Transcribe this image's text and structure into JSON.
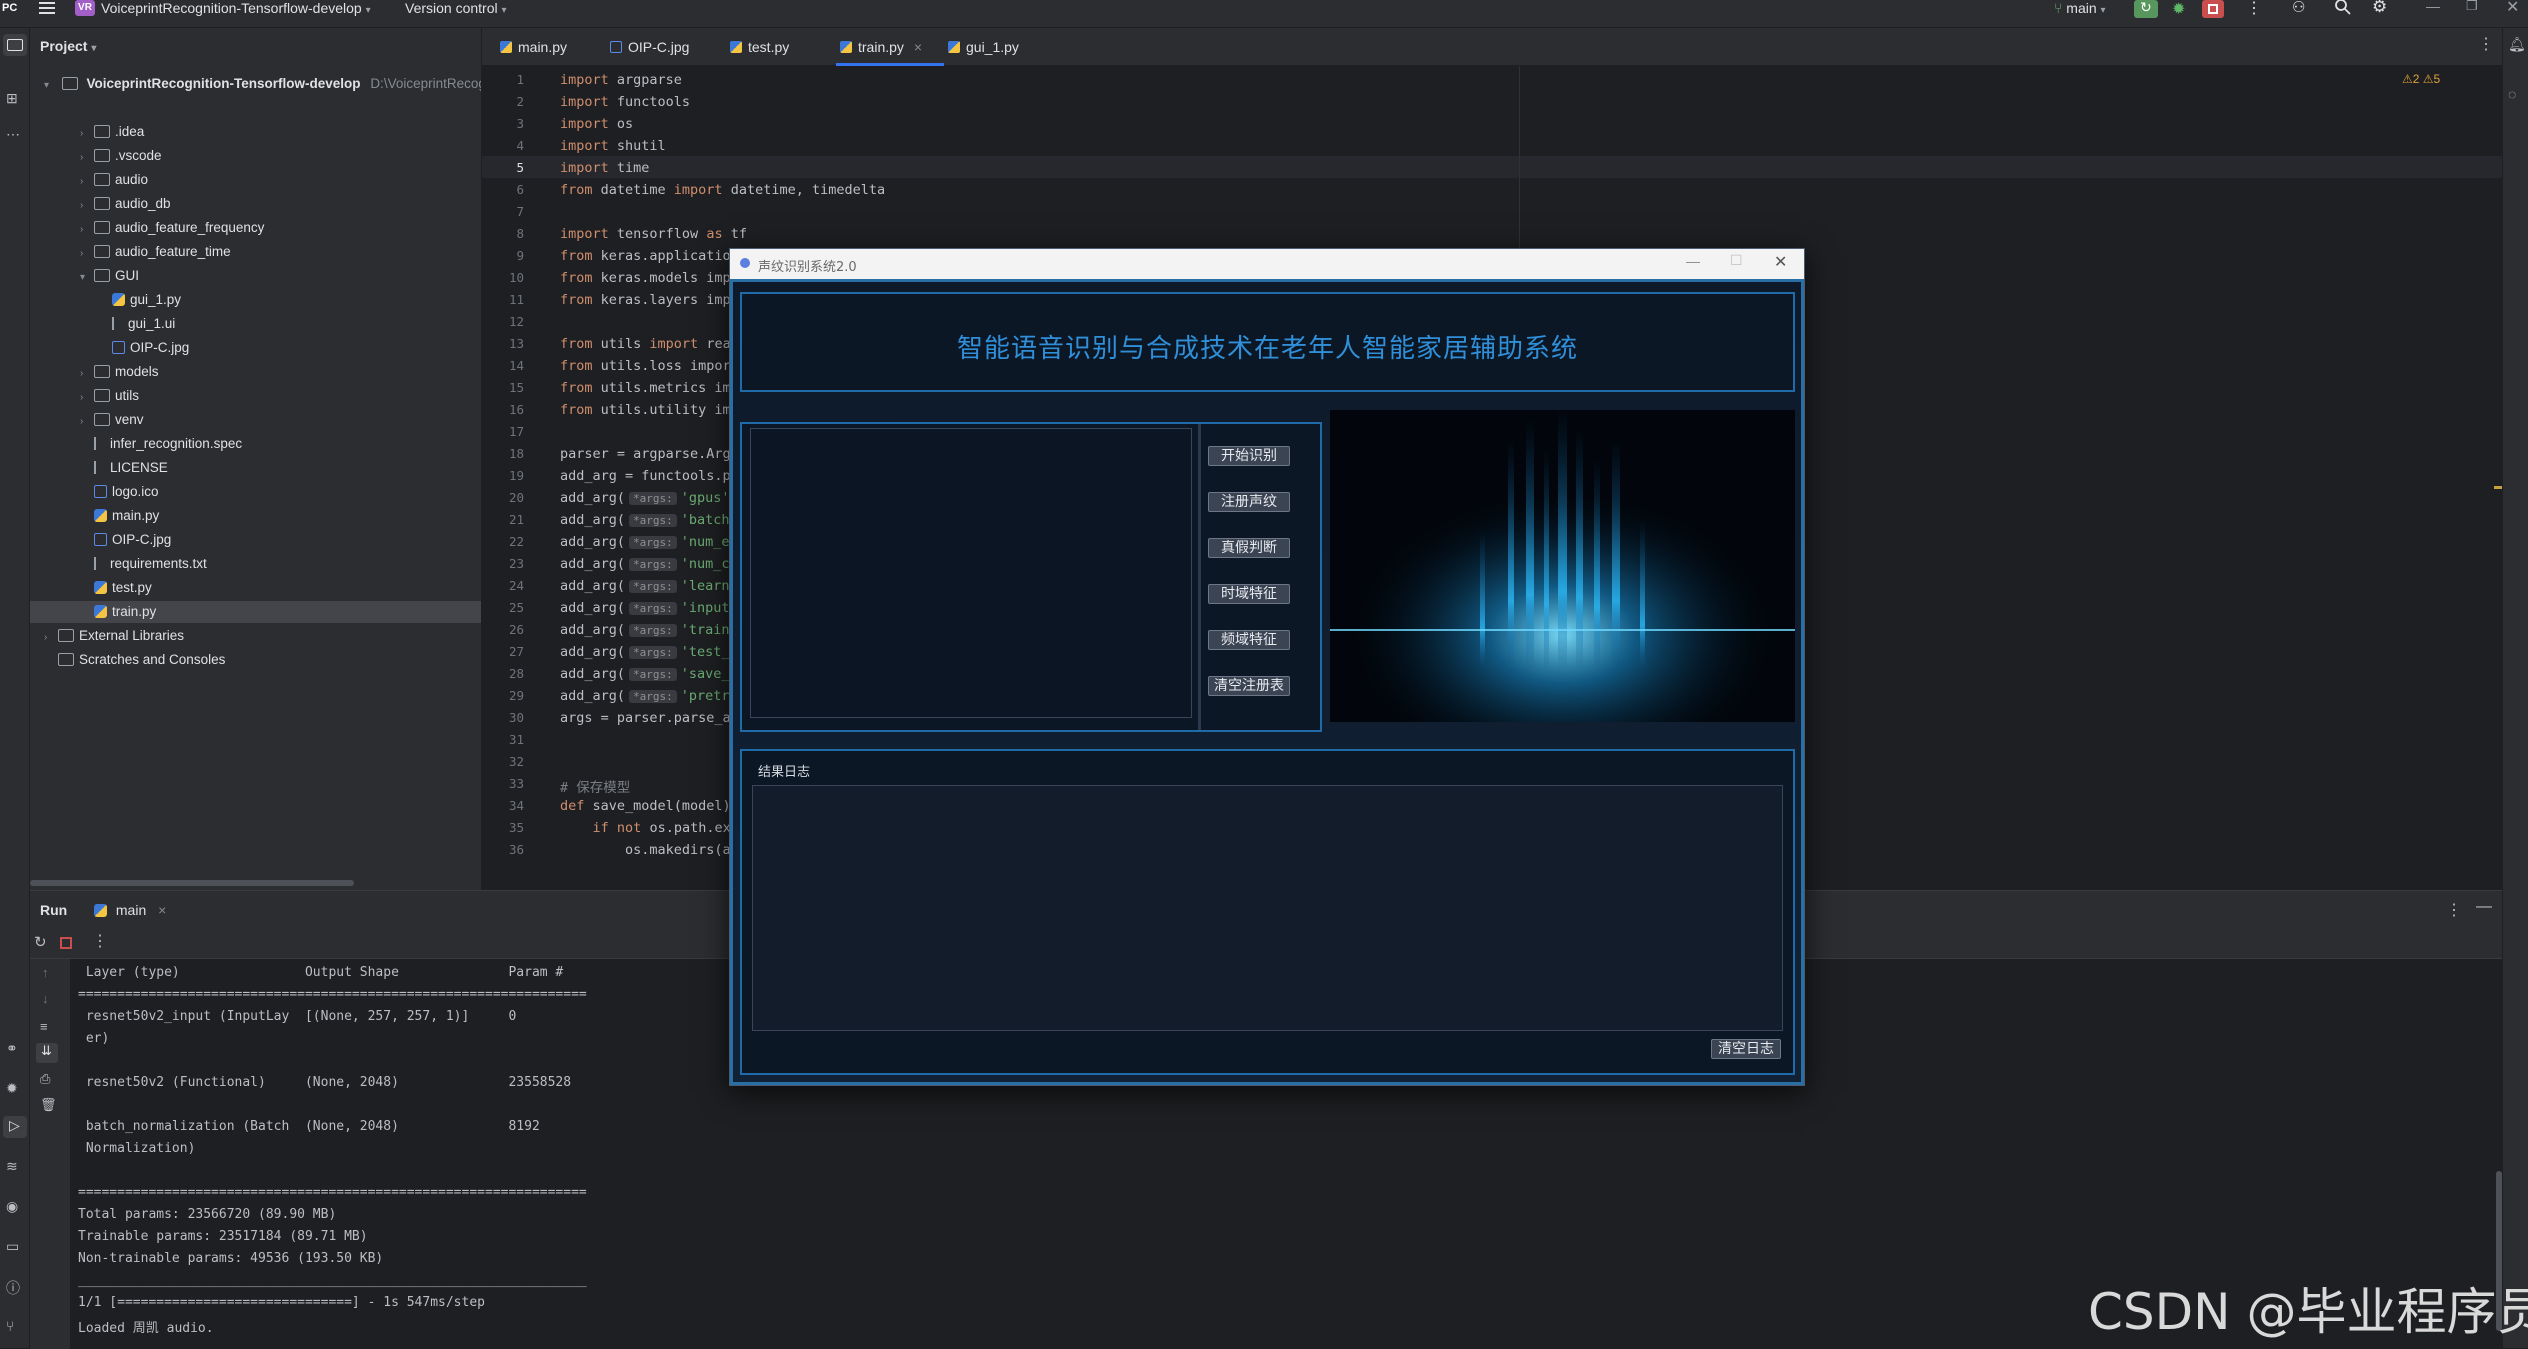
{
  "titlebar": {
    "app_icon": "PC",
    "project_badge": "VR",
    "project_name": "VoiceprintRecognition-Tensorflow-develop",
    "vcs": "Version control",
    "branch": "main"
  },
  "project_panel": {
    "title": "Project",
    "root_name": "VoiceprintRecognition-Tensorflow-develop",
    "root_path": "D:\\VoiceprintRecogni",
    "items": [
      {
        "label": "VoiceprintRecognition-Tensorflow-develop",
        "kind": "folder"
      },
      {
        "label": ".idea",
        "kind": "folder"
      },
      {
        "label": ".vscode",
        "kind": "folder"
      },
      {
        "label": "audio",
        "kind": "folder"
      },
      {
        "label": "audio_db",
        "kind": "folder"
      },
      {
        "label": "audio_feature_frequency",
        "kind": "folder"
      },
      {
        "label": "audio_feature_time",
        "kind": "folder"
      },
      {
        "label": "GUI",
        "kind": "folder"
      },
      {
        "label": "gui_1.py",
        "kind": "py"
      },
      {
        "label": "gui_1.ui",
        "kind": "ui"
      },
      {
        "label": "OIP-C.jpg",
        "kind": "img"
      },
      {
        "label": "models",
        "kind": "folder"
      },
      {
        "label": "utils",
        "kind": "folder"
      },
      {
        "label": "venv",
        "kind": "folder"
      },
      {
        "label": "infer_recognition.spec",
        "kind": "txt"
      },
      {
        "label": "LICENSE",
        "kind": "txt"
      },
      {
        "label": "logo.ico",
        "kind": "img"
      },
      {
        "label": "main.py",
        "kind": "py"
      },
      {
        "label": "OIP-C.jpg",
        "kind": "img"
      },
      {
        "label": "requirements.txt",
        "kind": "txt"
      },
      {
        "label": "test.py",
        "kind": "py"
      },
      {
        "label": "train.py",
        "kind": "py"
      },
      {
        "label": "External Libraries",
        "kind": "lib"
      },
      {
        "label": "Scratches and Consoles",
        "kind": "lib"
      }
    ]
  },
  "tabs": [
    {
      "label": "main.py"
    },
    {
      "label": "OIP-C.jpg"
    },
    {
      "label": "test.py"
    },
    {
      "label": "train.py",
      "close": "×"
    },
    {
      "label": "gui_1.py"
    }
  ],
  "editor": {
    "warnings": "⚠2 ⚠5",
    "lines": [
      {
        "n": "1",
        "text": "import argparse"
      },
      {
        "n": "2",
        "text": "import functools"
      },
      {
        "n": "3",
        "text": "import os"
      },
      {
        "n": "4",
        "text": "import shutil"
      },
      {
        "n": "5",
        "text": "import time"
      },
      {
        "n": "6",
        "text": "from datetime import datetime, timedelta"
      },
      {
        "n": "7",
        "text": ""
      },
      {
        "n": "8",
        "text": "import tensorflow as tf"
      },
      {
        "n": "9",
        "text": "from keras.applicatio"
      },
      {
        "n": "10",
        "text": "from keras.models imp"
      },
      {
        "n": "11",
        "text": "from keras.layers imp"
      },
      {
        "n": "12",
        "text": ""
      },
      {
        "n": "13",
        "text": "from utils import rea"
      },
      {
        "n": "14",
        "text": "from utils.loss impor"
      },
      {
        "n": "15",
        "text": "from utils.metrics im"
      },
      {
        "n": "16",
        "text": "from utils.utility im"
      },
      {
        "n": "17",
        "text": ""
      },
      {
        "n": "18",
        "text": "parser = argparse.Arg"
      },
      {
        "n": "19",
        "text": "add_arg = functools.p"
      },
      {
        "n": "20",
        "text": "add_arg(",
        "hint": "*args:",
        "rest": "'gpus',"
      },
      {
        "n": "21",
        "text": "add_arg(",
        "hint": "*args:",
        "rest": "'batch_"
      },
      {
        "n": "22",
        "text": "add_arg(",
        "hint": "*args:",
        "rest": "'num_ep"
      },
      {
        "n": "23",
        "text": "add_arg(",
        "hint": "*args:",
        "rest": "'num_cl"
      },
      {
        "n": "24",
        "text": "add_arg(",
        "hint": "*args:",
        "rest": "'learni"
      },
      {
        "n": "25",
        "text": "add_arg(",
        "hint": "*args:",
        "rest": "'input_"
      },
      {
        "n": "26",
        "text": "add_arg(",
        "hint": "*args:",
        "rest": "'train_"
      },
      {
        "n": "27",
        "text": "add_arg(",
        "hint": "*args:",
        "rest": "'test_l"
      },
      {
        "n": "28",
        "text": "add_arg(",
        "hint": "*args:",
        "rest": "'save_m"
      },
      {
        "n": "29",
        "text": "add_arg(",
        "hint": "*args:",
        "rest": "'pretra"
      },
      {
        "n": "30",
        "text": "args = parser.parse_a"
      },
      {
        "n": "31",
        "text": ""
      },
      {
        "n": "32",
        "text": ""
      },
      {
        "n": "33",
        "text": "# 保存模型"
      },
      {
        "n": "34",
        "text": "def save_model(model)"
      },
      {
        "n": "35",
        "text": "    if not os.path.ex"
      },
      {
        "n": "36",
        "text": "        os.makedirs(a"
      }
    ]
  },
  "run_panel": {
    "tab_run": "Run",
    "tab_config": "main",
    "output": [
      " Layer (type)                Output Shape              Param #",
      "=================================================================",
      " resnet50v2_input (InputLay  [(None, 257, 257, 1)]     0",
      " er)",
      "",
      " resnet50v2 (Functional)     (None, 2048)              23558528",
      "",
      " batch_normalization (Batch  (None, 2048)              8192",
      " Normalization)",
      "",
      "=================================================================",
      "Total params: 23566720 (89.90 MB)",
      "Trainable params: 23517184 (89.71 MB)",
      "Non-trainable params: 49536 (193.50 KB)",
      "_________________________________________________________________",
      "1/1 [==============================] - 1s 547ms/step",
      "Loaded 周凯 audio."
    ]
  },
  "app": {
    "window_title": "声纹识别系统2.0",
    "header": "智能语音识别与合成技术在老年人智能家居辅助系统",
    "buttons": [
      "开始识别",
      "注册声纹",
      "真假判断",
      "时域特征",
      "频域特征",
      "清空注册表"
    ],
    "log_label": "结果日志",
    "clear_log": "清空日志"
  },
  "watermark": "CSDN @毕业程序员",
  "colors": {
    "accent": "#3574f0",
    "app_title_text": "#2f8fd8",
    "app_border": "#1f6aa8"
  }
}
